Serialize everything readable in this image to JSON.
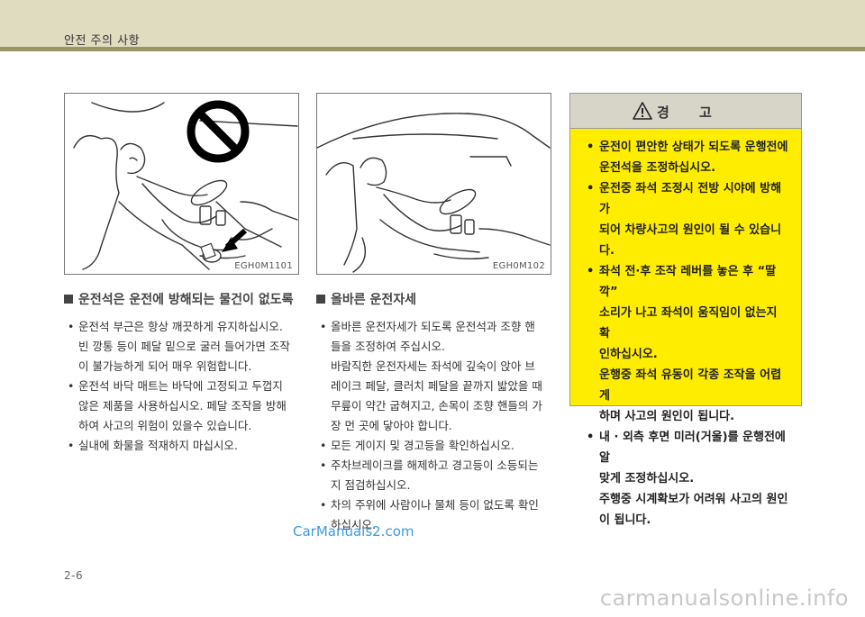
{
  "header": {
    "title": "안전 주의 사항"
  },
  "figures": [
    {
      "code": "EGH0M1101"
    },
    {
      "code": "EGH0M102"
    }
  ],
  "warning": {
    "title": "경 고",
    "items": [
      {
        "lines": [
          "운전이 편안한 상태가 되도록 운행전에",
          "운전석을 조정하십시오."
        ]
      },
      {
        "lines": [
          "운전중 좌석 조정시 전방 시야에 방해가",
          "되어 차량사고의 원인이 될 수 있습니다."
        ]
      },
      {
        "lines": [
          "좌석 전·후 조작 레버를 놓은 후 “딸깍”",
          "소리가 나고 좌석이 움직임이 없는지 확",
          "인하십시오.",
          "운행중 좌석 유동이 각종 조작을 어렵게",
          "하며 사고의 원인이 됩니다."
        ]
      },
      {
        "lines": [
          "내 · 외측 후면 미러(거울)를 운행전에 알",
          "맞게 조정하십시오.",
          "주행중 시계확보가 어려워 사고의 원인",
          "이 됩니다."
        ]
      }
    ]
  },
  "section1": {
    "title": "운전석은 운전에 방해되는 물건이 없도록",
    "items": [
      {
        "lines": [
          "운전석 부근은 항상 깨끗하게 유지하십시오.",
          "빈 깡통 등이 페달 밑으로 굴러 들어가면 조작",
          "이 불가능하게 되어 매우 위험합니다."
        ]
      },
      {
        "lines": [
          "운전석 바닥 매트는 바닥에 고정되고 두껍지",
          "않은 제품을 사용하십시오. 페달 조작을 방해",
          "하여 사고의 위험이 있을수 있습니다."
        ]
      },
      {
        "lines": [
          "실내에 화물을 적재하지 마십시오."
        ]
      }
    ]
  },
  "section2": {
    "title": "올바른 운전자세",
    "items": [
      {
        "lines": [
          "올바른 운전자세가 되도록 운전석과 조향 핸",
          "들을 조정하여 주십시오.",
          "바람직한 운전자세는 좌석에 깊숙이 앉아 브",
          "레이크 페달, 클러치 페달을 끝까지 밟았을 때",
          "무릎이 약간 굽혀지고, 손목이 조향 핸들의 가",
          "장 먼 곳에 닿아야 합니다."
        ]
      },
      {
        "lines": [
          "모든 게이지 및 경고등을 확인하십시오."
        ]
      },
      {
        "lines": [
          "주차브레이크를 해제하고 경고등이 소등되는",
          "지 점검하십시오."
        ]
      },
      {
        "lines": [
          "차의 주위에 사람이나 물체 등이 없도록 확인",
          "하십시오."
        ]
      }
    ]
  },
  "watermark": "CarManuals2.com",
  "page_number": "2-6",
  "footer_mark": "carmanualsonline.info"
}
